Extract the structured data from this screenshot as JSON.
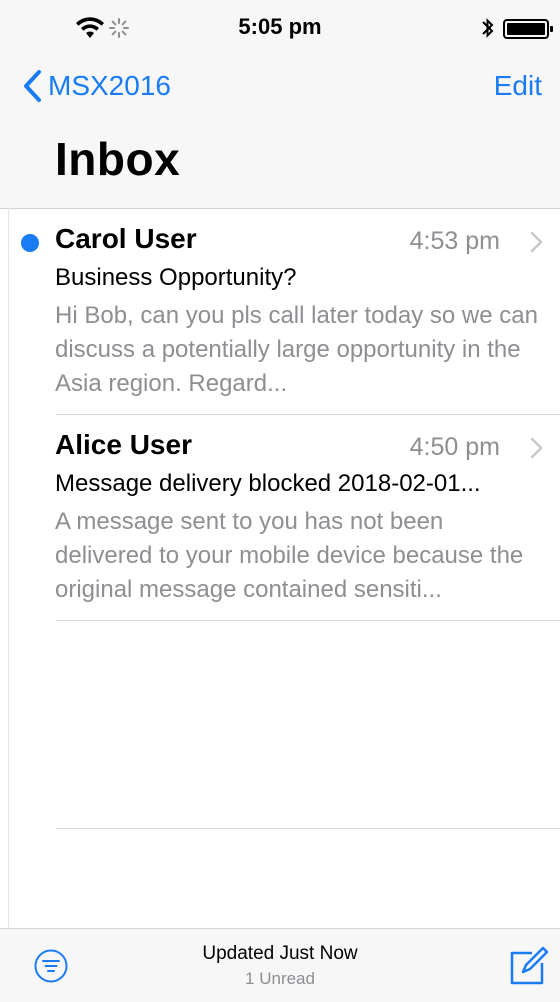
{
  "status_bar": {
    "time": "5:05 pm",
    "icons": [
      "wifi-icon",
      "activity-spinner-icon",
      "bluetooth-icon",
      "battery-icon"
    ]
  },
  "nav": {
    "back_label": "MSX2016",
    "edit_label": "Edit",
    "title": "Inbox"
  },
  "colors": {
    "accent": "#1a7cf5",
    "secondary_text": "#8e8e93",
    "separator": "#d6d6d6"
  },
  "messages": [
    {
      "sender": "Carol User",
      "time": "4:53 pm",
      "subject": "Business Opportunity?",
      "preview": "Hi Bob, can you pls call later today so we can discuss a potentially large opportunity in the Asia region. Regard...",
      "unread": true
    },
    {
      "sender": "Alice User",
      "time": "4:50 pm",
      "subject": "Message delivery blocked 2018-02-01...",
      "preview": "A message sent to you has not been delivered to your mobile device because the original message contained sensiti...",
      "unread": false
    }
  ],
  "toolbar": {
    "status_main": "Updated Just Now",
    "status_sub": "1 Unread",
    "filter_icon": "filter-icon",
    "compose_icon": "compose-icon"
  }
}
